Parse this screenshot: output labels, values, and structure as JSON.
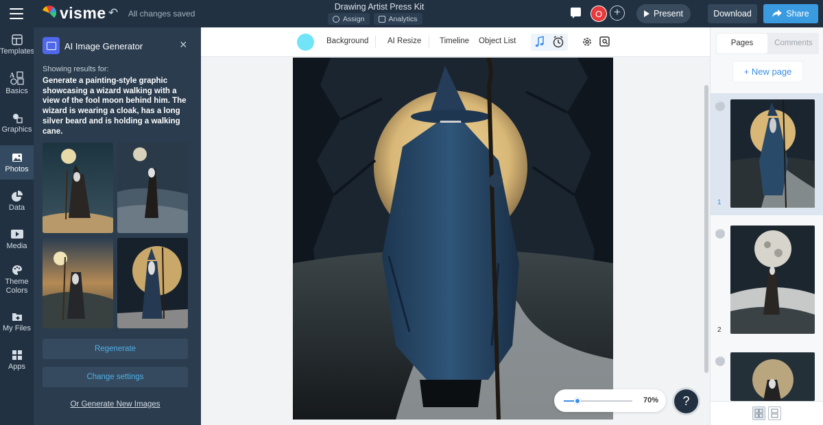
{
  "header": {
    "logo_text": "visme",
    "save_status": "All changes saved",
    "document_title": "Drawing Artist Press Kit",
    "assign_label": "Assign",
    "analytics_label": "Analytics",
    "avatar_initial": "O",
    "present_label": "Present",
    "download_label": "Download",
    "share_label": "Share",
    "colors": {
      "background": "#213142",
      "share": "#3a9be0",
      "avatar": "#e8393c"
    }
  },
  "rail": {
    "items": [
      {
        "label": "Templates",
        "icon": "templates-icon"
      },
      {
        "label": "Basics",
        "icon": "basics-icon"
      },
      {
        "label": "Graphics",
        "icon": "graphics-icon"
      },
      {
        "label": "Photos",
        "icon": "photos-icon",
        "active": true
      },
      {
        "label": "Data",
        "icon": "data-pie-icon"
      },
      {
        "label": "Media",
        "icon": "media-icon"
      },
      {
        "label": "Theme",
        "label2": "Colors",
        "icon": "palette-icon"
      },
      {
        "label": "My Files",
        "icon": "folder-icon"
      },
      {
        "label": "Apps",
        "icon": "apps-grid-icon"
      }
    ]
  },
  "panel": {
    "title": "AI Image Generator",
    "results_label": "Showing results for:",
    "prompt": "Generate a painting-style graphic showcasing a wizard walking with a view of the fool moon behind him. The wizard is wearing a cloak, has a long silver beard and is holding a walking cane.",
    "regenerate_label": "Regenerate",
    "change_settings_label": "Change settings",
    "generate_new_label": "Or Generate New Images"
  },
  "toolbar": {
    "background_label": "Background",
    "ai_resize_label": "AI Resize",
    "timeline_label": "Timeline",
    "object_list_label": "Object List",
    "swatch_color": "#72e4f8"
  },
  "canvas": {
    "zoom": {
      "label": "70%",
      "level": 0.2
    },
    "help_label": "?",
    "page_marker": "1"
  },
  "pages_panel": {
    "tab_pages": "Pages",
    "tab_comments": "Comments",
    "new_page_label": "+ New page",
    "pages": [
      {
        "number": "1",
        "selected": true
      },
      {
        "number": "2",
        "selected": false
      },
      {
        "number": "",
        "selected": false
      }
    ]
  }
}
